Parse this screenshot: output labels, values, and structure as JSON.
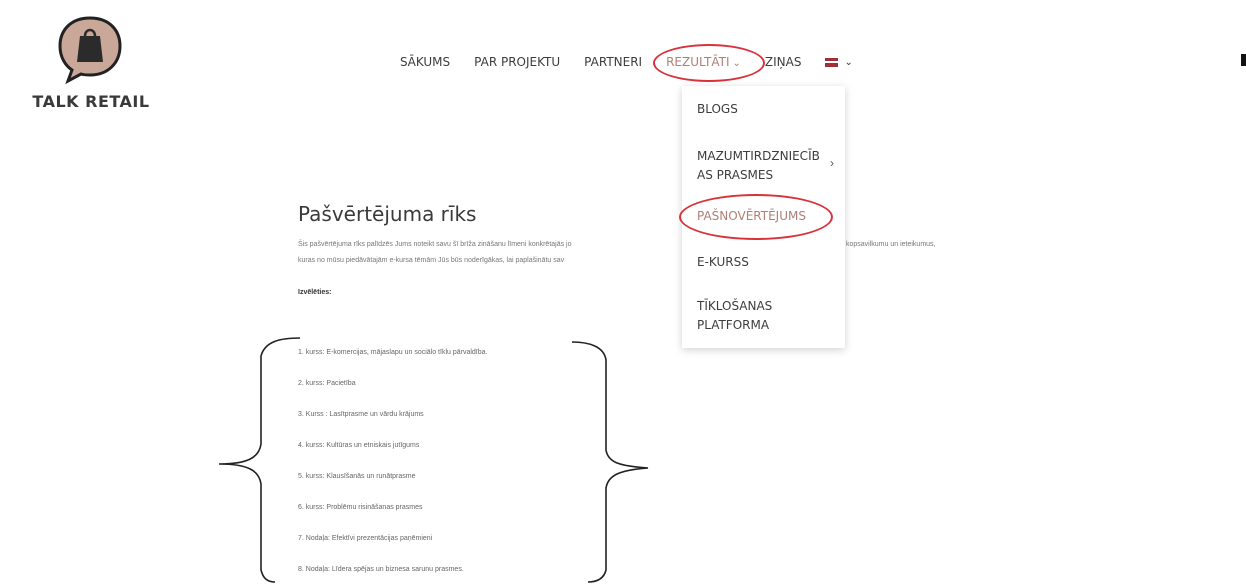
{
  "brand": {
    "name": "TALK RETAIL"
  },
  "colors": {
    "accent": "#b07f75",
    "annotation": "#d8333b",
    "logo_bg": "#c9a89a",
    "text": "#3d3d3d"
  },
  "nav": {
    "items": [
      {
        "label": "SĀKUMS"
      },
      {
        "label": "PAR PROJEKTU"
      },
      {
        "label": "PARTNERI"
      },
      {
        "label": "REZULTĀTI",
        "active": true,
        "icon": "chevron-down-icon"
      },
      {
        "label": "ZIŅAS"
      }
    ],
    "language": {
      "icon": "latvia-flag-icon",
      "chevron": "chevron-down-icon"
    }
  },
  "dropdown": {
    "items": [
      {
        "label": "BLOGS"
      },
      {
        "label_line1": "MAZUMTIRDZNIECĪB",
        "label_line2": "AS PRASMES",
        "has_submenu": true,
        "icon": "chevron-right-icon"
      },
      {
        "label": "PAŠNOVĒRTĒJUMS",
        "active": true
      },
      {
        "label": "E-KURSS"
      },
      {
        "label_line1": "TĪKLOŠANAS",
        "label_line2": "PLATFORMA"
      }
    ]
  },
  "main": {
    "title": "Pašvērtējuma rīks",
    "intro_line1": "Šis pašvērtējuma rīks palīdzēs Jums noteikt savu šī brīža zināšanu līmeni konkrētajās jo",
    "intro_line2": "kuras no mūsu piedāvātajām e-kursa tēmām Jūs būs noderīgākas, lai paplašinātu sav",
    "intro_right": "kopsavilkumu un ieteikumus,",
    "select_label": "Izvēlēties:",
    "courses": [
      "1. kurss: E-komercijas, mājaslapu un sociālo tīklu pārvaldība.",
      "2. kurss: Pacietība",
      "3. Kurss : Lasītprasme un vārdu krājums",
      "4. kurss: Kultūras un etniskais jutīgums",
      "5. kurss: Klausīšanās un runātprasme",
      "6. kurss: Problēmu risināšanas prasmes",
      "7. Nodaļa: Efektīvi prezentācijas paņēmieni",
      "8. Nodaļa: Līdera spējas un biznesa sarunu prasmes."
    ]
  }
}
